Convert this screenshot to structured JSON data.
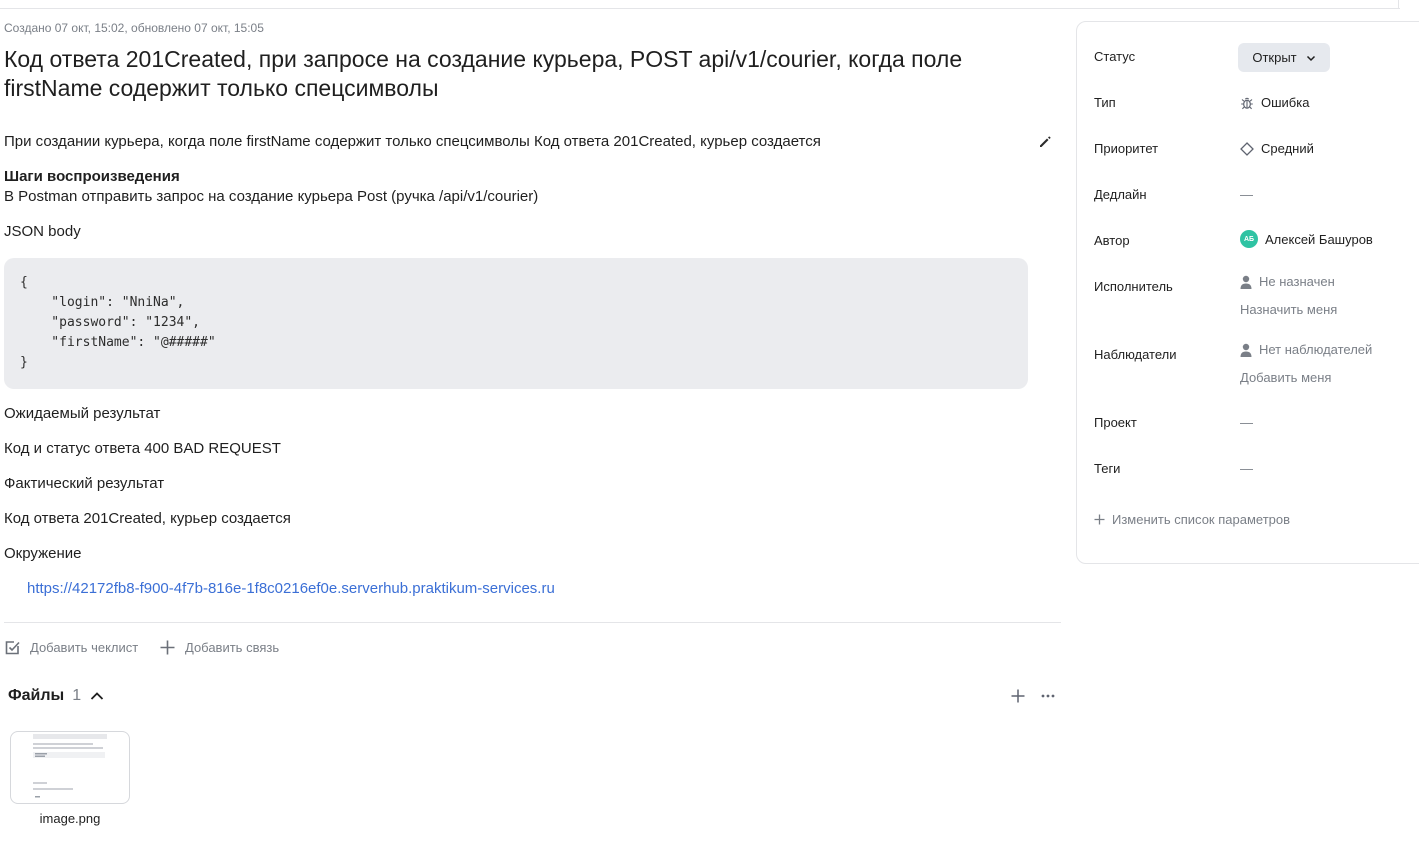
{
  "issue": {
    "meta": "Создано 07 окт, 15:02, обновлено 07 окт, 15:05",
    "title": "Код ответа 201Created, при запросе на создание курьера, POST api/v1/courier, когда поле firstName содержит только спецсимволы",
    "description": "При создании курьера, когда поле firstName содержит только спецсимволы Код ответа 201Created, курьер создается",
    "steps_title": "Шаги воспроизведения",
    "steps_text": "В Postman отправить запрос на создание курьера Post (ручка /api/v1/courier)",
    "json_label": "JSON body",
    "code_lines": [
      "{",
      "    \"login\": \"NniNa\",",
      "    \"password\": \"1234\",",
      "    \"firstName\": \"@#####\"",
      "}"
    ],
    "expected_label": "Ожидаемый результат",
    "expected_text": "Код и статус ответа 400 BAD REQUEST",
    "actual_label": "Фактический результат",
    "actual_text": "Код ответа 201Created, курьер создается",
    "env_label": "Окружение",
    "env_link": "https://42172fb8-f900-4f7b-816e-1f8c0216ef0e.serverhub.praktikum-services.ru"
  },
  "actions": {
    "add_checklist": "Добавить чеклист",
    "add_link": "Добавить связь"
  },
  "files": {
    "title": "Файлы",
    "count": "1",
    "items": [
      {
        "name": "image.png"
      }
    ]
  },
  "sidebar": {
    "status": {
      "label": "Статус",
      "value": "Открыт"
    },
    "type": {
      "label": "Тип",
      "value": "Ошибка",
      "icon": "bug-icon"
    },
    "priority": {
      "label": "Приоритет",
      "value": "Средний",
      "icon": "diamond-icon"
    },
    "deadline": {
      "label": "Дедлайн",
      "value": "—"
    },
    "author": {
      "label": "Автор",
      "value": "Алексей Башуров",
      "initials": "АБ"
    },
    "assignee": {
      "label": "Исполнитель",
      "value": "Не назначен",
      "action": "Назначить меня"
    },
    "followers": {
      "label": "Наблюдатели",
      "value": "Нет наблюдателей",
      "action": "Добавить меня"
    },
    "project": {
      "label": "Проект",
      "value": "—"
    },
    "tags": {
      "label": "Теги",
      "value": "—"
    },
    "edit_params": "Изменить список параметров"
  },
  "colors": {
    "link": "#3b6fd6",
    "avatar": "#2fc3a3",
    "code_bg": "#ebecef",
    "status_bg": "#e6e9ee"
  }
}
